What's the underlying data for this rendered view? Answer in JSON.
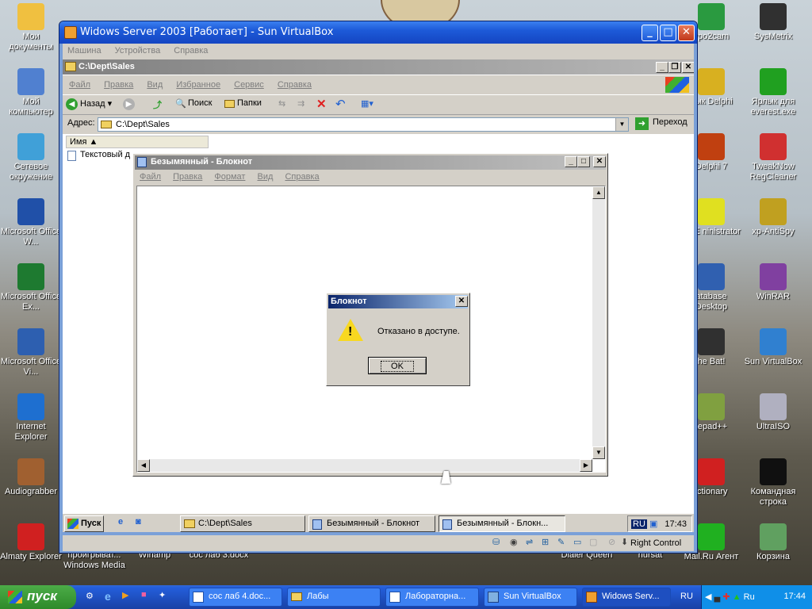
{
  "desktop": {
    "icons_left": [
      {
        "label": "Мои документы",
        "color": "#f0c040"
      },
      {
        "label": "Мой компьютер",
        "color": "#5080d0"
      },
      {
        "label": "Сетевое окружение",
        "color": "#40a0d8"
      },
      {
        "label": "Microsoft Office W...",
        "color": "#2050a8"
      },
      {
        "label": "Microsoft Office Ex...",
        "color": "#1e7a30"
      },
      {
        "label": "Microsoft Office Vi...",
        "color": "#2d5fb0"
      },
      {
        "label": "Internet Explorer",
        "color": "#1e6fd0"
      },
      {
        "label": "Audiograbber",
        "color": "#a06030"
      },
      {
        "label": "Almaty Explorer",
        "color": "#d02020"
      }
    ],
    "icons_right_col1": [
      {
        "label": "ypo2cam",
        "color": "#2a9a40"
      },
      {
        "label": "лык Delphi",
        "color": "#d8b020"
      },
      {
        "label": "Delphi 7",
        "color": "#c04010"
      },
      {
        "label": "BDE ninistrator",
        "color": "#e0e020"
      },
      {
        "label": "atabase Desktop",
        "color": "#3060b0"
      },
      {
        "label": "he Bat!",
        "color": "#303030"
      },
      {
        "label": "tepad++",
        "color": "#80a040"
      },
      {
        "label": "ictionary",
        "color": "#d02020"
      },
      {
        "label": "Mail.Ru Агент",
        "color": "#20b020"
      }
    ],
    "icons_right_col2": [
      {
        "label": "SysMetrix",
        "color": "#303030"
      },
      {
        "label": "Ярлык для everest.exe",
        "color": "#20a020"
      },
      {
        "label": "TweakNow RegCleaner",
        "color": "#d03030"
      },
      {
        "label": "xp-AntiSpy",
        "color": "#c0a020"
      },
      {
        "label": "WinRAR",
        "color": "#8040a0"
      },
      {
        "label": "Sun VirtualBox",
        "color": "#3080d0"
      },
      {
        "label": "UltraISO",
        "color": "#b0b0c0"
      },
      {
        "label": "Командная строка",
        "color": "#101010"
      },
      {
        "label": "Корзина",
        "color": "#60a060"
      }
    ],
    "partial_labels": [
      "проигрыват... Windows Media",
      "Winamp",
      "сос лаб 3.docx",
      "Dialer Queen",
      "hursat"
    ]
  },
  "vbox": {
    "title": "Widows Server 2003 [Работает] - Sun VirtualBox",
    "menu": [
      "Машина",
      "Устройства",
      "Справка"
    ],
    "status_right": "Right Control"
  },
  "explorer": {
    "title": "C:\\Dept\\Sales",
    "menu": [
      "Файл",
      "Правка",
      "Вид",
      "Избранное",
      "Сервис",
      "Справка"
    ],
    "back": "Назад",
    "search": "Поиск",
    "folders": "Папки",
    "address_label": "Адрес:",
    "address_value": "C:\\Dept\\Sales",
    "go": "Переход",
    "column_name": "Имя",
    "file_item": "Текстовый д"
  },
  "notepad": {
    "title": "Безымянный - Блокнот",
    "menu": [
      "Файл",
      "Правка",
      "Формат",
      "Вид",
      "Справка"
    ]
  },
  "dialog": {
    "title": "Блокнот",
    "message": "Отказано в доступе.",
    "ok": "OK"
  },
  "guest_taskbar": {
    "start": "Пуск",
    "tasks": [
      "C:\\Dept\\Sales",
      "Безымянный - Блокнот",
      "Безымянный - Блокн..."
    ],
    "lang": "RU",
    "clock": "17:43"
  },
  "host_taskbar": {
    "start": "пуск",
    "tasks": [
      "сос лаб 4.doc...",
      "Лабы",
      "Лабораторна...",
      "Sun VirtualBox",
      "Widows Serv..."
    ],
    "lang": "RU",
    "clock": "17:44"
  }
}
